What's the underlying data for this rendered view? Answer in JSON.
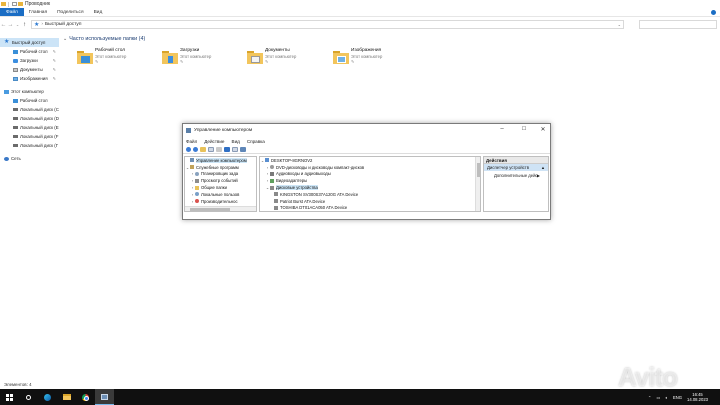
{
  "window": {
    "title": "Проводник"
  },
  "ribbon": {
    "tabs": [
      "Файл",
      "Главная",
      "Поделиться",
      "Вид"
    ]
  },
  "address": {
    "path": "Быстрый доступ"
  },
  "nav": {
    "quick_access": "Быстрый доступ",
    "pinned": [
      "Рабочий стол",
      "Загрузки",
      "Документы",
      "Изображения"
    ],
    "this_pc": "Этот компьютер",
    "pc_items": [
      "Рабочий стол",
      "Локальный диск (C",
      "Локальный диск (D",
      "Локальный диск (E",
      "Локальный диск (F",
      "Локальный диск (Г"
    ],
    "network": "Сеть"
  },
  "content": {
    "section_title": "Часто используемые папки (4)",
    "folders": [
      {
        "name": "Рабочий стол",
        "location": "Этот компьютер"
      },
      {
        "name": "Загрузки",
        "location": "Этот компьютер"
      },
      {
        "name": "Документы",
        "location": "Этот компьютер"
      },
      {
        "name": "Изображения",
        "location": "Этот компьютер"
      }
    ]
  },
  "status": {
    "items_count": "Элементов: 4"
  },
  "mmc": {
    "title": "Управление компьютером",
    "menu": [
      "Файл",
      "Действие",
      "Вид",
      "Справка"
    ],
    "left_tree": [
      "Управление компьютером",
      "Служебные программ",
      "Планировщик зада",
      "Просмотр событий",
      "Общие папки",
      "Локальные пользов",
      "Производительнос"
    ],
    "device_tree": [
      "DESKTOP-8GRNOV2",
      "DVD-дисководы и дисководы компакт-дисков",
      "Аудиовходы и аудиовыходы",
      "Видеоадаптеры",
      "Дисковые устройства",
      "KINGSTON SV300S37A120G ATA Device",
      "Patriot Burst ATA Device",
      "TOSHIBA DT01ACA050 ATA Device"
    ],
    "actions": {
      "header": "Действия",
      "selected": "Диспетчер устройств",
      "more": "Дополнительные дейс"
    }
  },
  "taskbar": {
    "language": "ENG",
    "time": "16:45",
    "date": "14.08.2023"
  },
  "watermark": "Avito"
}
